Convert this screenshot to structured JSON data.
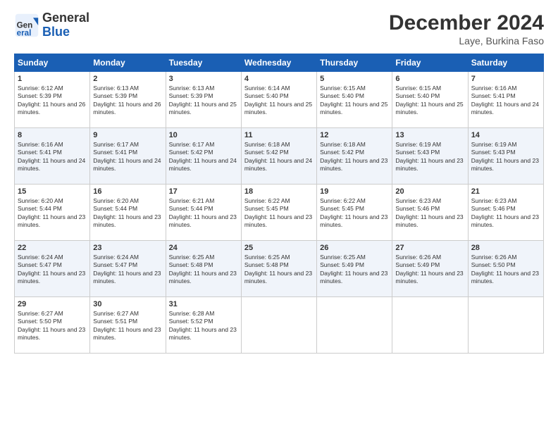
{
  "header": {
    "logo_general": "General",
    "logo_blue": "Blue",
    "month_title": "December 2024",
    "location": "Laye, Burkina Faso"
  },
  "weekdays": [
    "Sunday",
    "Monday",
    "Tuesday",
    "Wednesday",
    "Thursday",
    "Friday",
    "Saturday"
  ],
  "weeks": [
    [
      {
        "day": "1",
        "rise": "6:12 AM",
        "set": "5:39 PM",
        "daylight": "11 hours and 26 minutes."
      },
      {
        "day": "2",
        "rise": "6:13 AM",
        "set": "5:39 PM",
        "daylight": "11 hours and 26 minutes."
      },
      {
        "day": "3",
        "rise": "6:13 AM",
        "set": "5:39 PM",
        "daylight": "11 hours and 25 minutes."
      },
      {
        "day": "4",
        "rise": "6:14 AM",
        "set": "5:40 PM",
        "daylight": "11 hours and 25 minutes."
      },
      {
        "day": "5",
        "rise": "6:15 AM",
        "set": "5:40 PM",
        "daylight": "11 hours and 25 minutes."
      },
      {
        "day": "6",
        "rise": "6:15 AM",
        "set": "5:40 PM",
        "daylight": "11 hours and 25 minutes."
      },
      {
        "day": "7",
        "rise": "6:16 AM",
        "set": "5:41 PM",
        "daylight": "11 hours and 24 minutes."
      }
    ],
    [
      {
        "day": "8",
        "rise": "6:16 AM",
        "set": "5:41 PM",
        "daylight": "11 hours and 24 minutes."
      },
      {
        "day": "9",
        "rise": "6:17 AM",
        "set": "5:41 PM",
        "daylight": "11 hours and 24 minutes."
      },
      {
        "day": "10",
        "rise": "6:17 AM",
        "set": "5:42 PM",
        "daylight": "11 hours and 24 minutes."
      },
      {
        "day": "11",
        "rise": "6:18 AM",
        "set": "5:42 PM",
        "daylight": "11 hours and 24 minutes."
      },
      {
        "day": "12",
        "rise": "6:18 AM",
        "set": "5:42 PM",
        "daylight": "11 hours and 23 minutes."
      },
      {
        "day": "13",
        "rise": "6:19 AM",
        "set": "5:43 PM",
        "daylight": "11 hours and 23 minutes."
      },
      {
        "day": "14",
        "rise": "6:19 AM",
        "set": "5:43 PM",
        "daylight": "11 hours and 23 minutes."
      }
    ],
    [
      {
        "day": "15",
        "rise": "6:20 AM",
        "set": "5:44 PM",
        "daylight": "11 hours and 23 minutes."
      },
      {
        "day": "16",
        "rise": "6:20 AM",
        "set": "5:44 PM",
        "daylight": "11 hours and 23 minutes."
      },
      {
        "day": "17",
        "rise": "6:21 AM",
        "set": "5:44 PM",
        "daylight": "11 hours and 23 minutes."
      },
      {
        "day": "18",
        "rise": "6:22 AM",
        "set": "5:45 PM",
        "daylight": "11 hours and 23 minutes."
      },
      {
        "day": "19",
        "rise": "6:22 AM",
        "set": "5:45 PM",
        "daylight": "11 hours and 23 minutes."
      },
      {
        "day": "20",
        "rise": "6:23 AM",
        "set": "5:46 PM",
        "daylight": "11 hours and 23 minutes."
      },
      {
        "day": "21",
        "rise": "6:23 AM",
        "set": "5:46 PM",
        "daylight": "11 hours and 23 minutes."
      }
    ],
    [
      {
        "day": "22",
        "rise": "6:24 AM",
        "set": "5:47 PM",
        "daylight": "11 hours and 23 minutes."
      },
      {
        "day": "23",
        "rise": "6:24 AM",
        "set": "5:47 PM",
        "daylight": "11 hours and 23 minutes."
      },
      {
        "day": "24",
        "rise": "6:25 AM",
        "set": "5:48 PM",
        "daylight": "11 hours and 23 minutes."
      },
      {
        "day": "25",
        "rise": "6:25 AM",
        "set": "5:48 PM",
        "daylight": "11 hours and 23 minutes."
      },
      {
        "day": "26",
        "rise": "6:25 AM",
        "set": "5:49 PM",
        "daylight": "11 hours and 23 minutes."
      },
      {
        "day": "27",
        "rise": "6:26 AM",
        "set": "5:49 PM",
        "daylight": "11 hours and 23 minutes."
      },
      {
        "day": "28",
        "rise": "6:26 AM",
        "set": "5:50 PM",
        "daylight": "11 hours and 23 minutes."
      }
    ],
    [
      {
        "day": "29",
        "rise": "6:27 AM",
        "set": "5:50 PM",
        "daylight": "11 hours and 23 minutes."
      },
      {
        "day": "30",
        "rise": "6:27 AM",
        "set": "5:51 PM",
        "daylight": "11 hours and 23 minutes."
      },
      {
        "day": "31",
        "rise": "6:28 AM",
        "set": "5:52 PM",
        "daylight": "11 hours and 23 minutes."
      },
      null,
      null,
      null,
      null
    ]
  ],
  "labels": {
    "sunrise": "Sunrise:",
    "sunset": "Sunset:",
    "daylight": "Daylight:"
  }
}
